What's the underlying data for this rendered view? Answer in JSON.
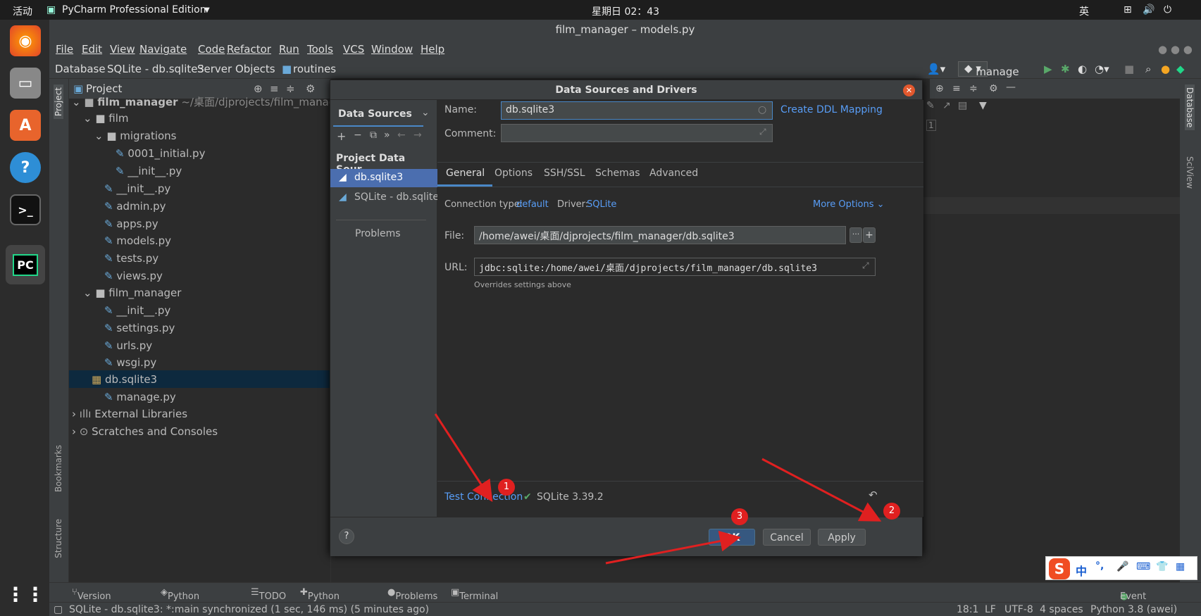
{
  "topbar": {
    "activities": "活动",
    "app_name": "PyCharm Professional Edition",
    "clock": "星期日 02：43",
    "ime": "英"
  },
  "window": {
    "title": "film_manager – models.py"
  },
  "menu": [
    "File",
    "Edit",
    "View",
    "Navigate",
    "Code",
    "Refactor",
    "Run",
    "Tools",
    "VCS",
    "Window",
    "Help"
  ],
  "breadcrumb": [
    "Database",
    "SQLite - db.sqlite3",
    "Server Objects",
    "routines"
  ],
  "run_config": "manage",
  "project_panel": {
    "title": "Project",
    "root": "film_manager",
    "root_path": "~/桌面/djprojects/film_manage",
    "items": [
      "film",
      "migrations",
      "0001_initial.py",
      "__init__.py",
      "__init__.py",
      "admin.py",
      "apps.py",
      "models.py",
      "tests.py",
      "views.py",
      "film_manager",
      "__init__.py",
      "settings.py",
      "urls.py",
      "wsgi.py",
      "db.sqlite3",
      "manage.py",
      "External Libraries",
      "Scratches and Consoles"
    ]
  },
  "left_strip": {
    "project": "Project",
    "bookmarks": "Bookmarks",
    "structure": "Structure"
  },
  "right_strip": {
    "database": "Database",
    "sciview": "SciView"
  },
  "editor": {
    "line_number": "1"
  },
  "dialog": {
    "title": "Data Sources and Drivers",
    "left_title": "Data Sources",
    "section": "Project Data Sour...",
    "sources": [
      "db.sqlite3",
      "SQLite - db.sqlite"
    ],
    "problems": "Problems",
    "name_label": "Name:",
    "name_value": "db.sqlite3",
    "create_ddl": "Create DDL Mapping",
    "comment_label": "Comment:",
    "tabs": [
      "General",
      "Options",
      "SSH/SSL",
      "Schemas",
      "Advanced"
    ],
    "conn_type_label": "Connection type:",
    "conn_type": "default",
    "driver_label": "Driver:",
    "driver": "SQLite",
    "more_options": "More Options",
    "file_label": "File:",
    "file_value": "/home/awei/桌面/djprojects/film_manager/db.sqlite3",
    "url_label": "URL:",
    "url_value": "jdbc:sqlite:/home/awei/桌面/djprojects/film_manager/db.sqlite3",
    "overrides": "Overrides settings above",
    "test_connection": "Test Connection",
    "test_result": "SQLite 3.39.2",
    "ok": "OK",
    "cancel": "Cancel",
    "apply": "Apply",
    "help": "?"
  },
  "annotations": [
    "1",
    "2",
    "3"
  ],
  "toolwindows": [
    "Version Control",
    "Python Packages",
    "TODO",
    "Python Console",
    "Problems",
    "Terminal",
    "Event Log"
  ],
  "status": {
    "message": "SQLite - db.sqlite3: *:main synchronized (1 sec, 146 ms) (5 minutes ago)",
    "position": "18:1",
    "line_sep": "LF",
    "encoding": "UTF-8",
    "indent": "4 spaces",
    "interpreter": "Python 3.8 (awei)"
  },
  "ime_bar": [
    "中",
    "°,"
  ]
}
